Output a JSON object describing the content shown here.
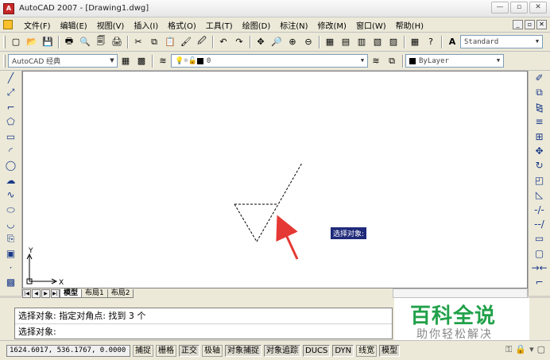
{
  "window": {
    "title": "AutoCAD 2007 - [Drawing1.dwg]",
    "app_icon": "A",
    "controls": [
      "minimize-icon",
      "restore-icon",
      "close-icon"
    ],
    "control_glyphs": [
      "—",
      "▫",
      "✕"
    ]
  },
  "menu": {
    "items": [
      "文件(F)",
      "编辑(E)",
      "视图(V)",
      "插入(I)",
      "格式(O)",
      "工具(T)",
      "绘图(D)",
      "标注(N)",
      "修改(M)",
      "窗口(W)",
      "帮助(H)"
    ],
    "mdi_glyphs": [
      "_",
      "▫",
      "✕"
    ]
  },
  "toolbar1": {
    "icons": [
      "new-icon",
      "open-icon",
      "save-icon",
      "print-icon",
      "preview-icon",
      "publish-icon",
      "plot-icon",
      "cut-icon",
      "copy-icon",
      "paste-icon",
      "matchprop-icon",
      "block-editor-icon",
      "undo-icon",
      "redo-icon",
      "pan-icon",
      "zoom-realtime-icon",
      "zoom-window-icon",
      "zoom-previous-icon",
      "properties-icon",
      "design-center-icon",
      "tool-palettes-icon",
      "sheet-set-icon",
      "markup-icon",
      "calculator-icon",
      "help-icon"
    ],
    "glyphs": [
      "▢",
      "📂",
      "💾",
      "🖶",
      "🔍",
      "🗐",
      "🖨",
      "✂",
      "⧉",
      "📋",
      "🖌",
      "🖉",
      "↶",
      "↷",
      "✥",
      "🔎",
      "⊕",
      "⊖",
      "▦",
      "▤",
      "▥",
      "▧",
      "▨",
      "▦",
      "?"
    ],
    "text_style_glyph": "A",
    "text_style": "Standard"
  },
  "toolbar2": {
    "workspace": "AutoCAD 经典",
    "layer_icons": [
      "layer-manager-icon",
      "lightbulb-icon",
      "sun-icon",
      "lock-icon"
    ],
    "layer_glyphs": [
      "≋",
      "💡",
      "☼",
      "🔓"
    ],
    "layer_name": "0",
    "color": "ByLayer"
  },
  "left_tools": {
    "icons": [
      "line-icon",
      "construction-line-icon",
      "polyline-icon",
      "polygon-icon",
      "rectangle-icon",
      "arc-icon",
      "circle-icon",
      "revision-cloud-icon",
      "spline-icon",
      "ellipse-icon",
      "ellipse-arc-icon",
      "insert-block-icon",
      "make-block-icon",
      "point-icon",
      "hatch-icon"
    ],
    "glyphs": [
      "╱",
      "⤢",
      "⌐",
      "⬠",
      "▭",
      "◜",
      "◯",
      "☁",
      "∿",
      "⬭",
      "◡",
      "⎘",
      "▣",
      "·",
      "▩"
    ]
  },
  "right_tools": {
    "icons": [
      "erase-icon",
      "copy-object-icon",
      "mirror-icon",
      "offset-icon",
      "array-icon",
      "move-icon",
      "rotate-icon",
      "scale-icon",
      "stretch-icon",
      "trim-icon",
      "extend-icon",
      "break-at-point-icon",
      "break-icon",
      "join-icon",
      "chamfer-icon"
    ],
    "glyphs": [
      "✐",
      "⧉",
      "⧎",
      "≡",
      "⊞",
      "✥",
      "↻",
      "◰",
      "◺",
      "-/-",
      "--/",
      "▭",
      "▢",
      "→←",
      "⌐"
    ]
  },
  "ucs": {
    "x_label": "X",
    "y_label": "Y"
  },
  "tooltip": "选择对象:",
  "tabs": {
    "nav": [
      "|◀",
      "◀",
      "▶",
      "▶|"
    ],
    "items": [
      "模型",
      "布局1",
      "布局2"
    ],
    "active": 0
  },
  "command": {
    "history": "选择对象: 指定对角点: 找到 3 个",
    "prompt": "选择对象:"
  },
  "watermark": {
    "main": "百科全说",
    "sub": "助你轻松解决"
  },
  "status": {
    "coords": "1624.6017, 536.1767, 0.0000",
    "toggles": [
      {
        "label": "捕捉",
        "on": false
      },
      {
        "label": "栅格",
        "on": false
      },
      {
        "label": "正交",
        "on": true
      },
      {
        "label": "极轴",
        "on": false
      },
      {
        "label": "对象捕捉",
        "on": true
      },
      {
        "label": "对象追踪",
        "on": true
      },
      {
        "label": "DUCS",
        "on": true
      },
      {
        "label": "DYN",
        "on": true
      },
      {
        "label": "线宽",
        "on": false
      },
      {
        "label": "模型",
        "on": true
      }
    ],
    "tray_icons": [
      "comm-center-icon",
      "lock-toolbar-icon",
      "tray-menu-icon",
      "clean-screen-icon"
    ],
    "tray_glyphs": [
      "⚿",
      "🔒",
      "▾",
      "▢"
    ]
  },
  "colors": {
    "arrow": "#e53935",
    "tooltip_bg": "#1f2a7a",
    "watermark_green": "#21a14a"
  }
}
